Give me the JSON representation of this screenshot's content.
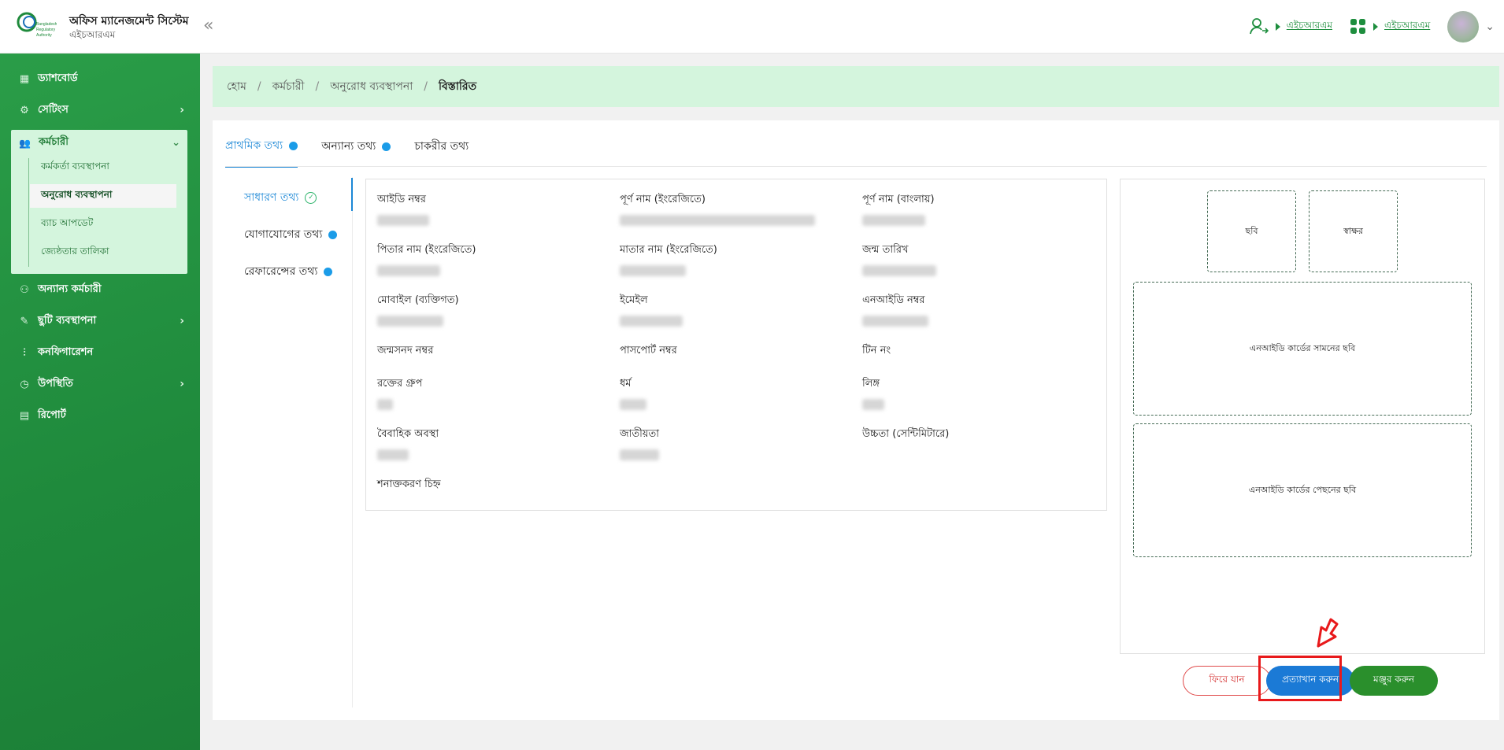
{
  "header": {
    "logo_text": "Bangladesh Regulatory Authority",
    "title": "অফিস ম্যানেজমেন্ট সিস্টেম",
    "subtitle": "এইচআরএম",
    "collapse_icon": "double-chevron-left-icon",
    "links": [
      {
        "icon": "user-switch-icon",
        "label": "এইচআরএম"
      },
      {
        "icon": "apps-grid-icon",
        "label": "এইচআরএম"
      }
    ]
  },
  "sidebar": {
    "items": [
      {
        "label": "ড্যাশবোর্ড",
        "icon": "dashboard-icon"
      },
      {
        "label": "সেটিংস",
        "icon": "gear-icon"
      },
      {
        "label": "কর্মচারী",
        "icon": "users-icon"
      },
      {
        "label": "অন্যান্য কর্মচারী",
        "icon": "group-icon"
      },
      {
        "label": "ছুটি ব্যবস্থাপনা",
        "icon": "leave-icon"
      },
      {
        "label": "কনফিগারেশন",
        "icon": "sliders-icon"
      },
      {
        "label": "উপস্থিতি",
        "icon": "clock-icon"
      },
      {
        "label": "রিপোর্ট",
        "icon": "document-icon"
      }
    ],
    "employee_sub": [
      "কর্মকর্তা ব্যবস্থাপনা",
      "অনুরোধ ব্যবস্থাপনা",
      "ব্যাচ আপডেট",
      "জ্যেষ্ঠতার তালিকা"
    ]
  },
  "breadcrumb": [
    "হোম",
    "কর্মচারী",
    "অনুরোধ ব্যবস্থাপনা",
    "বিস্তারিত"
  ],
  "tabs": [
    "প্রাথমিক তথ্য",
    "অন্যান্য তথ্য",
    "চাকরীর তথ্য"
  ],
  "subnav": [
    "সাধারণ তথ্য",
    "যোগাযোগের তথ্য",
    "রেফারেন্সের তথ্য"
  ],
  "fields": [
    {
      "label": "আইডি নম্বর"
    },
    {
      "label": "পূর্ণ নাম (ইংরেজিতে)"
    },
    {
      "label": "পূর্ণ নাম (বাংলায়)"
    },
    {
      "label": "পিতার নাম (ইংরেজিতে)"
    },
    {
      "label": "মাতার নাম (ইংরেজিতে)"
    },
    {
      "label": "জন্ম তারিখ"
    },
    {
      "label": "মোবাইল (ব্যক্তিগত)"
    },
    {
      "label": "ইমেইল"
    },
    {
      "label": "এনআইডি নম্বর"
    },
    {
      "label": "জন্মসনদ নম্বর"
    },
    {
      "label": "পাসপোর্ট নম্বর"
    },
    {
      "label": "টিন নং"
    },
    {
      "label": "রক্তের গ্রুপ"
    },
    {
      "label": "ধর্ম"
    },
    {
      "label": "লিঙ্গ"
    },
    {
      "label": "বৈবাহিক অবস্থা"
    },
    {
      "label": "জাতীয়তা"
    },
    {
      "label": "উচ্চতা (সেন্টিমিটারে)"
    },
    {
      "label": "শনাক্তকরণ চিহ্ন"
    }
  ],
  "photo_boxes": {
    "photo": "ছবি",
    "signature": "স্বাক্ষর",
    "nid_front": "এনআইডি কার্ডের সামনের ছবি",
    "nid_back": "এনআইডি কার্ডের পেছনের ছবি"
  },
  "buttons": {
    "back": "ফিরে যান",
    "reject": "প্রত্যাখান করুন",
    "approve": "মঞ্জুর করুন"
  },
  "colors": {
    "brand_green": "#1f8a3c",
    "accent_blue": "#1b87d6",
    "highlight_red": "#e8191b"
  }
}
